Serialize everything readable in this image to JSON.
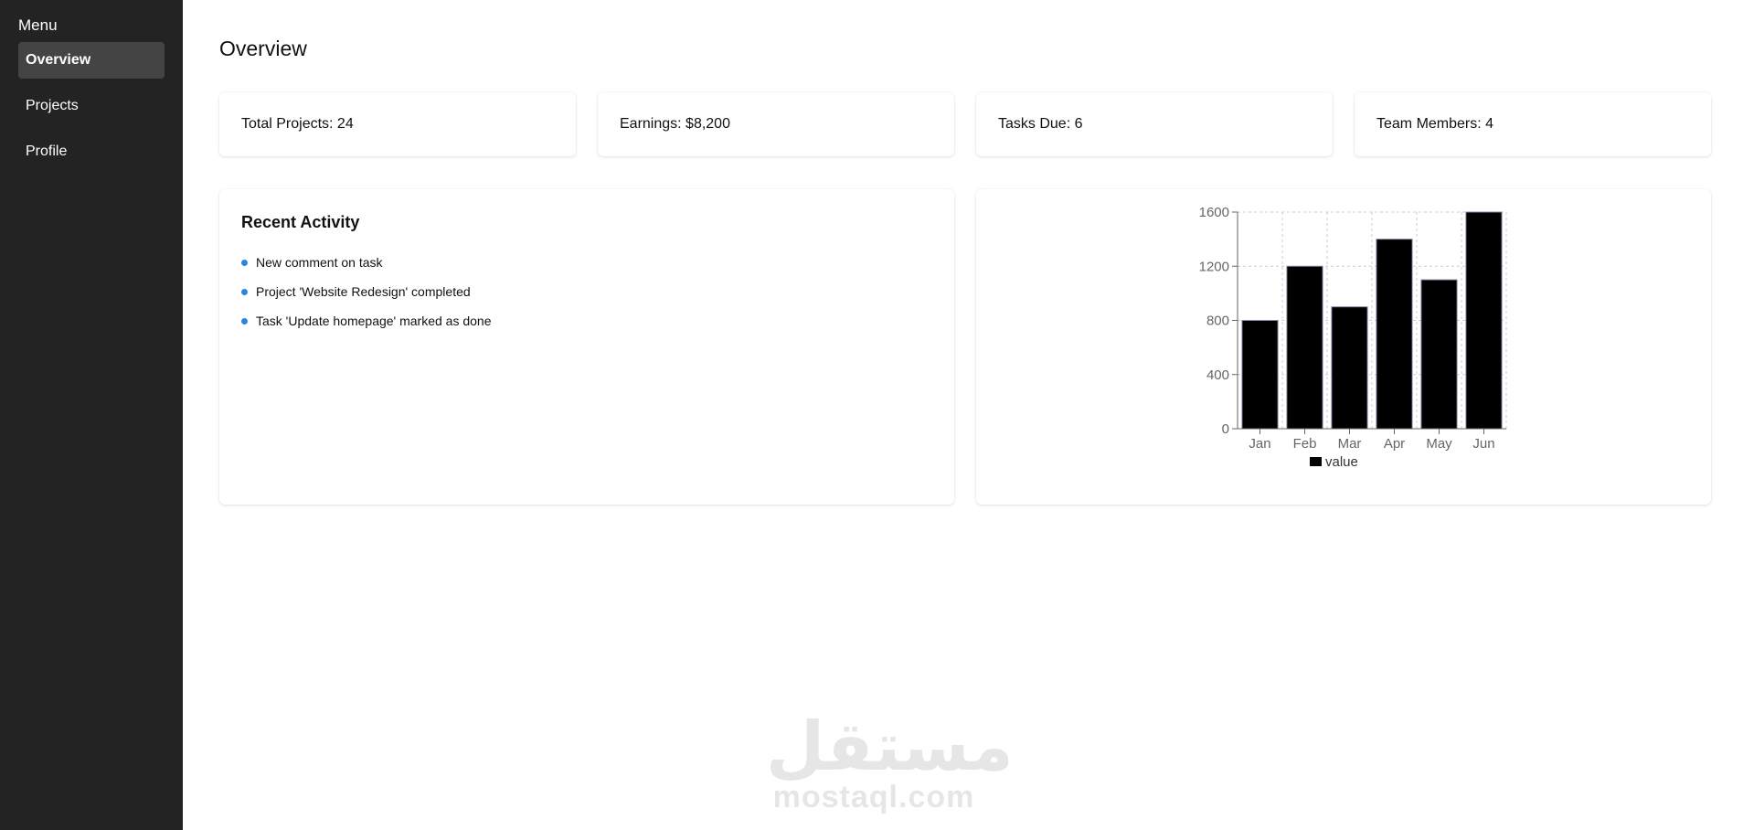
{
  "sidebar": {
    "title": "Menu",
    "items": [
      {
        "label": "Overview",
        "active": true
      },
      {
        "label": "Projects",
        "active": false
      },
      {
        "label": "Profile",
        "active": false
      }
    ]
  },
  "main": {
    "title": "Overview",
    "stats": [
      {
        "label": "Total Projects: 24"
      },
      {
        "label": "Earnings: $8,200"
      },
      {
        "label": "Tasks Due: 6"
      },
      {
        "label": "Team Members: 4"
      }
    ],
    "activity": {
      "title": "Recent Activity",
      "bullet_color": "#2b86e0",
      "items": [
        "New comment on task",
        "Project 'Website Redesign' completed",
        "Task 'Update homepage' marked as done"
      ]
    }
  },
  "chart_data": {
    "type": "bar",
    "categories": [
      "Jan",
      "Feb",
      "Mar",
      "Apr",
      "May",
      "Jun"
    ],
    "values": [
      800,
      1200,
      900,
      1400,
      1100,
      1600
    ],
    "series": [
      {
        "name": "value",
        "values": [
          800,
          1200,
          900,
          1400,
          1100,
          1600
        ]
      }
    ],
    "ylim": [
      0,
      1600
    ],
    "yticks": [
      0,
      400,
      800,
      1200,
      1600
    ],
    "grid": true,
    "legend": "bottom-center",
    "bar_color": "#000000",
    "title": "",
    "xlabel": "",
    "ylabel": ""
  },
  "watermark": {
    "arabic": "مستقل",
    "latin": "mostaql.com"
  }
}
